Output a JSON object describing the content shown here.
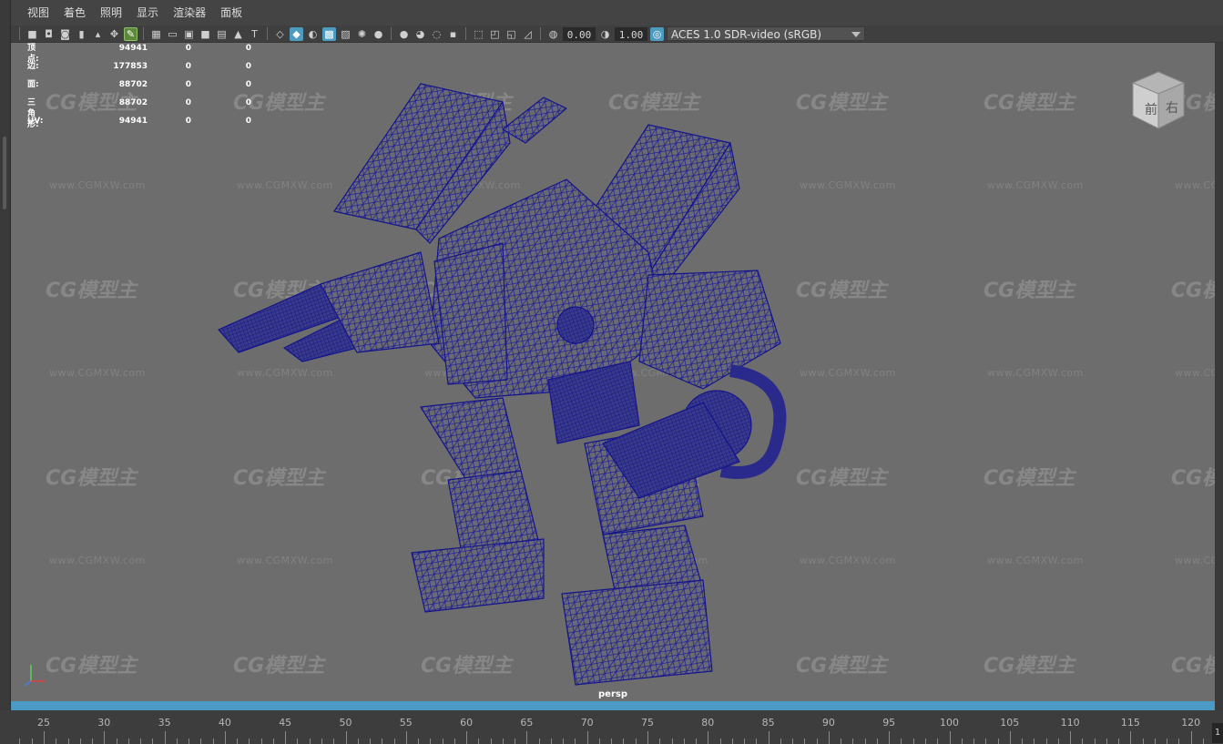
{
  "menu": {
    "items": [
      "视图",
      "着色",
      "照明",
      "显示",
      "渲染器",
      "面板"
    ]
  },
  "toolbar": {
    "exposure_value": "0.00",
    "gamma_value": "1.00",
    "color_space": "ACES 1.0 SDR-video (sRGB)"
  },
  "hud": {
    "rows": [
      {
        "label": "顶点:",
        "v1": "94941",
        "v2": "0",
        "v3": "0"
      },
      {
        "label": "边:",
        "v1": "177853",
        "v2": "0",
        "v3": "0"
      },
      {
        "label": "面:",
        "v1": "88702",
        "v2": "0",
        "v3": "0"
      },
      {
        "label": "三角形:",
        "v1": "88702",
        "v2": "0",
        "v3": "0"
      },
      {
        "label": "UV:",
        "v1": "94941",
        "v2": "0",
        "v3": "0"
      }
    ]
  },
  "viewport": {
    "camera_label": "persp",
    "watermark_logo": "CG模型主",
    "watermark_url": "www.CGMXW.com",
    "wireframe_color": "#1a1a9a",
    "background_color": "#6d6d6d"
  },
  "viewcube": {
    "front_label": "前",
    "right_label": "右"
  },
  "timeline": {
    "ticks": [
      25,
      30,
      35,
      40,
      45,
      50,
      55,
      60,
      65,
      70,
      75,
      80,
      85,
      90,
      95,
      100,
      105,
      110,
      115,
      120
    ],
    "end_value": "1"
  },
  "colors": {
    "accent": "#4b9ac3",
    "panel": "#444444"
  }
}
